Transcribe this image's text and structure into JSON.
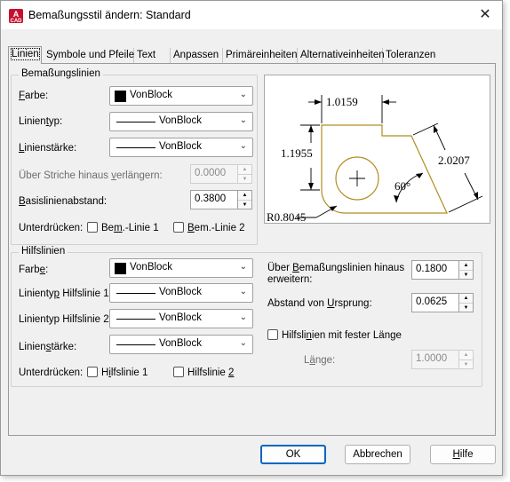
{
  "window": {
    "title": "Bemaßungsstil ändern: Standard",
    "app_icon_letter": "A",
    "app_icon_sub": "CAD"
  },
  "tabs": [
    "Linien",
    "Symbole und Pfeile",
    "Text",
    "Anpassen",
    "Primäreinheiten",
    "Alternativeinheiten",
    "Toleranzen"
  ],
  "active_tab": "Linien",
  "dimension_lines": {
    "group_label": "Bemaßungslinien",
    "color_label": "Farbe:",
    "color_value": "VonBlock",
    "linetype_label": "Linientyp:",
    "linetype_value": "VonBlock",
    "lineweight_label": "Linienstärke:",
    "lineweight_value": "VonBlock",
    "extend_label": "Über Striche hinaus verlängern:",
    "extend_value": "0.0000",
    "baseline_label": "Basislinienabstand:",
    "baseline_value": "0.3800",
    "suppress_label": "Unterdrücken:",
    "suppress_1": "Bem.-Linie 1",
    "suppress_2": "Bem.-Linie 2"
  },
  "extension_lines": {
    "group_label": "Hilfslinien",
    "color_label": "Farbe:",
    "color_value": "VonBlock",
    "linetype1_label": "Linientyp Hilfslinie 1:",
    "linetype1_value": "VonBlock",
    "linetype2_label": "Linientyp Hilfslinie 2.:",
    "linetype2_value": "VonBlock",
    "lineweight_label": "Linienstärke:",
    "lineweight_value": "VonBlock",
    "suppress_label": "Unterdrücken:",
    "suppress_1": "Hilfslinie 1",
    "suppress_2": "Hilfslinie 2",
    "extend_beyond_label": "Über Bemaßungslinien hinaus erweitern:",
    "extend_beyond_value": "0.1800",
    "offset_label": "Abstand von Ursprung:",
    "offset_value": "0.0625",
    "fixed_length_label": "Hilfslinien mit fester Länge",
    "length_label": "Länge:",
    "length_value": "1.0000"
  },
  "preview": {
    "dim_top": "1.0159",
    "dim_left": "1.1955",
    "dim_right": "2.0207",
    "angle": "60°",
    "radius": "R0.8045"
  },
  "buttons": {
    "ok": "OK",
    "cancel": "Abbrechen",
    "help": "Hilfe"
  },
  "colors": {
    "accent": "#0067c0",
    "app_icon": "#c8102e",
    "preview_geometry": "#b08d1e"
  }
}
